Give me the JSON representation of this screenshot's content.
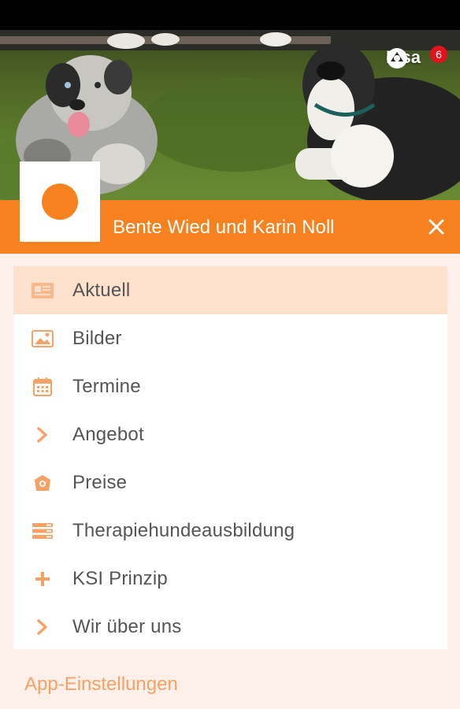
{
  "user": {
    "name": "Lisa",
    "notification_count": "6"
  },
  "header": {
    "title": "Bente Wied und Karin Noll"
  },
  "menu": {
    "items": [
      {
        "label": "Aktuell",
        "icon": "newspaper-icon",
        "active": true
      },
      {
        "label": "Bilder",
        "icon": "image-icon",
        "active": false
      },
      {
        "label": "Termine",
        "icon": "calendar-icon",
        "active": false
      },
      {
        "label": "Angebot",
        "icon": "chevron-right-icon",
        "active": false
      },
      {
        "label": "Preise",
        "icon": "price-tag-icon",
        "active": false
      },
      {
        "label": "Therapiehundeausbildung",
        "icon": "list-icon",
        "active": false
      },
      {
        "label": "KSI Prinzip",
        "icon": "plus-icon",
        "active": false
      },
      {
        "label": "Wir über uns",
        "icon": "chevron-right-icon",
        "active": false
      }
    ]
  },
  "footer": {
    "settings_label": "App-Einstellungen"
  },
  "colors": {
    "accent": "#f5821f",
    "active_bg": "#fde1cc",
    "badge": "#e3121c",
    "page_bg": "#fdf0ea"
  }
}
